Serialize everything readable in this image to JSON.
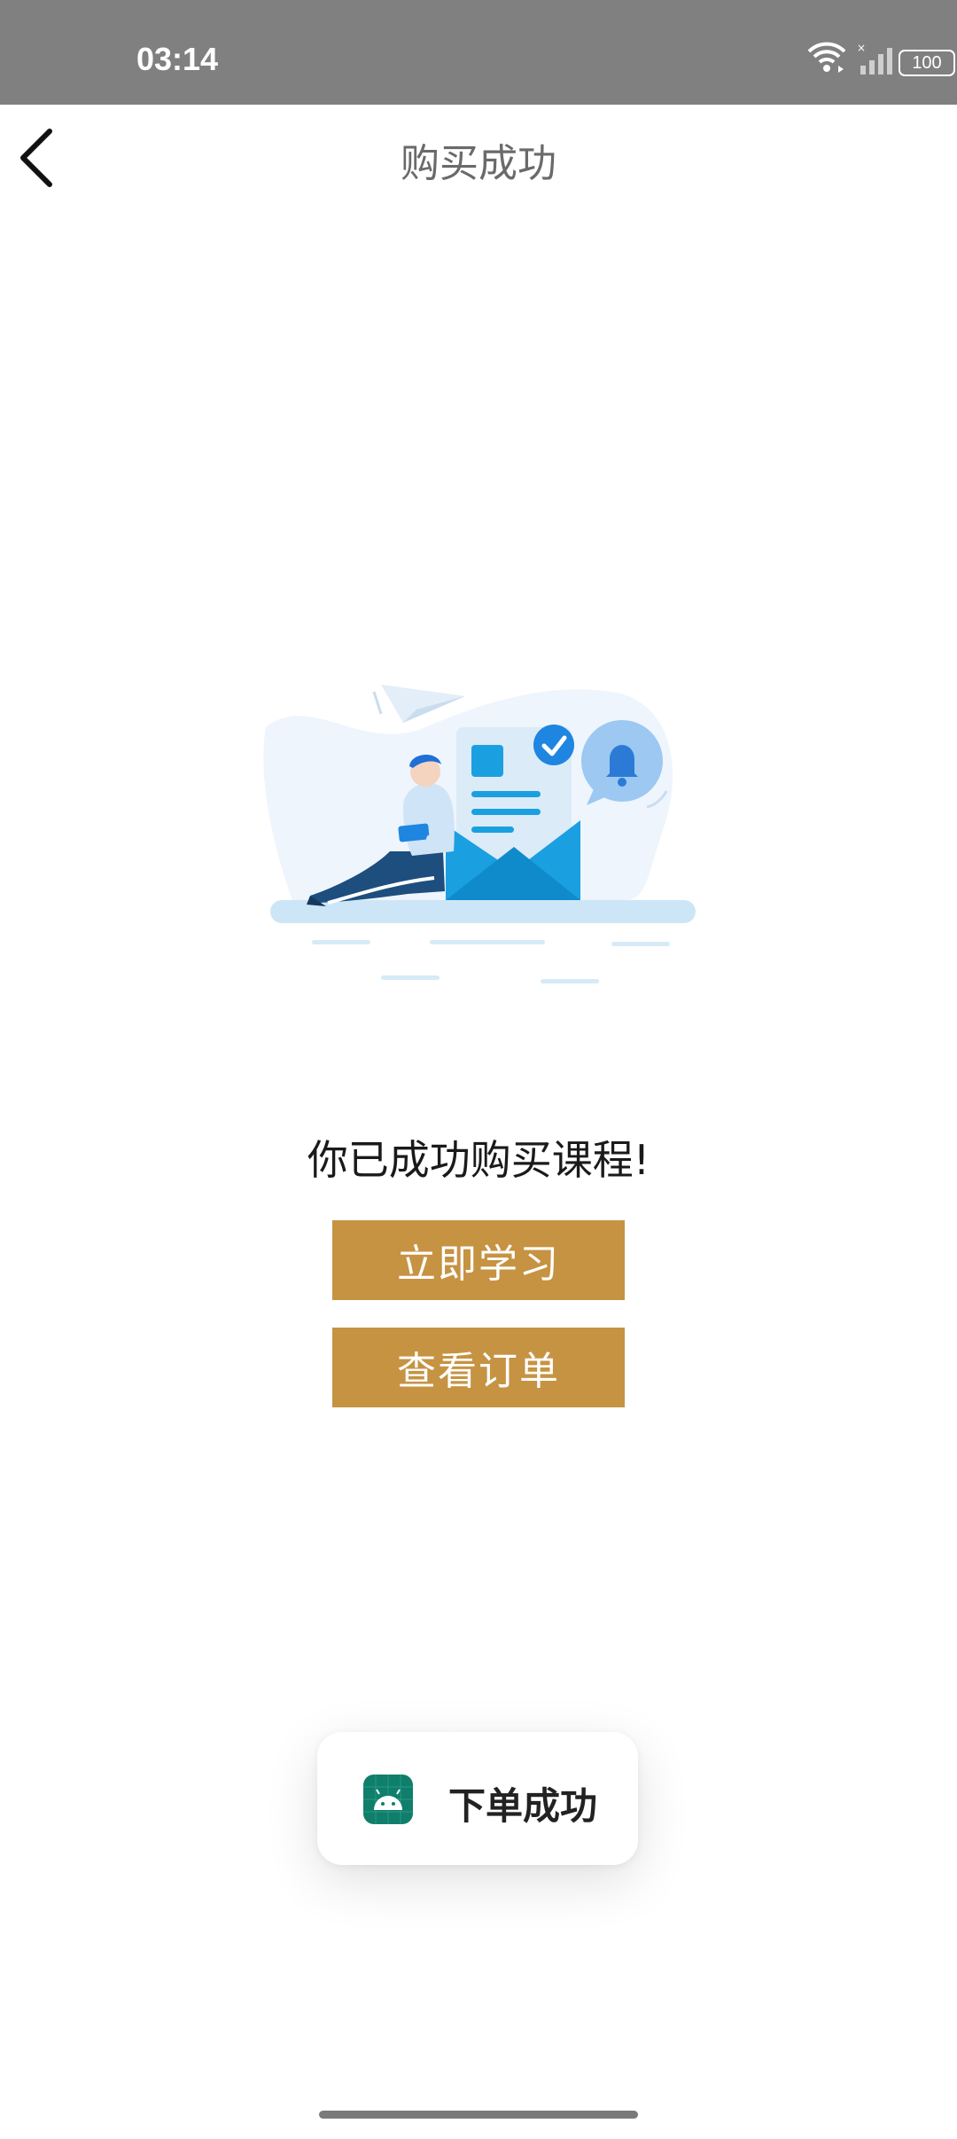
{
  "status_bar": {
    "time": "03:14",
    "battery": "100",
    "icons": [
      "wifi-icon",
      "signal-icon",
      "battery-icon"
    ]
  },
  "header": {
    "title": "购买成功",
    "back_icon": "chevron-left-icon"
  },
  "main": {
    "message": "你已成功购买课程!",
    "buttons": {
      "study": "立即学习",
      "orders": "查看订单"
    }
  },
  "toast": {
    "text": "下单成功",
    "icon": "android-app-icon"
  },
  "colors": {
    "status_bar": "#808080",
    "accent": "#c69343",
    "title": "#6a6a6a",
    "illustration_blue": "#1aa0e0"
  }
}
